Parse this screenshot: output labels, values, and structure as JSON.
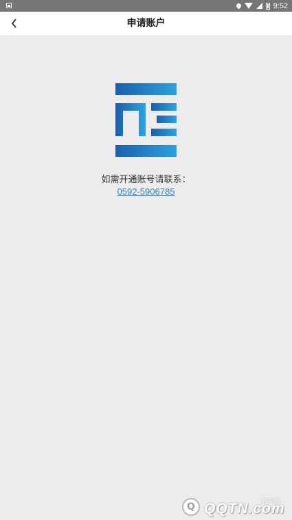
{
  "status_bar": {
    "time": "9:52",
    "icons": [
      "image-icon",
      "location-icon",
      "wifi-icon",
      "signal-icon",
      "battery-icon"
    ]
  },
  "header": {
    "title": "申请账户",
    "back_icon": "back-arrow-icon"
  },
  "main": {
    "contact_text": "如需开通账号请联系：",
    "phone": "0592-5906785"
  },
  "watermark": {
    "brand": "QQTN.com",
    "small": "腾牛网",
    "mark": "Q"
  },
  "colors": {
    "brand_blue": "#1e6fb5",
    "link": "#2c86c9",
    "background": "#ececec"
  }
}
